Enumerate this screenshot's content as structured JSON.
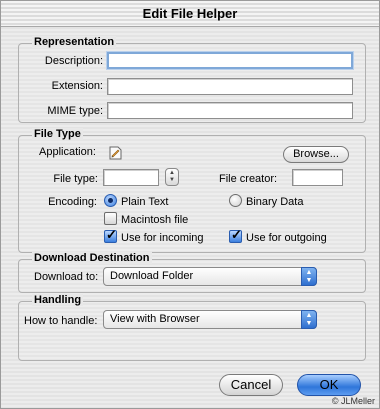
{
  "window": {
    "title": "Edit File Helper"
  },
  "representation": {
    "group_label": "Representation",
    "description_label": "Description:",
    "description_value": "",
    "extension_label": "Extension:",
    "extension_value": "",
    "mime_label": "MIME type:",
    "mime_value": ""
  },
  "file_type": {
    "group_label": "File Type",
    "application_label": "Application:",
    "application_icon": "application-document-icon",
    "browse_label": "Browse...",
    "file_type_label": "File type:",
    "file_type_value": "",
    "file_creator_label": "File creator:",
    "file_creator_value": "",
    "encoding_label": "Encoding:",
    "encoding_options": [
      "Plain Text",
      "Binary Data"
    ],
    "encoding_selected": "Plain Text",
    "macintosh_file_label": "Macintosh file",
    "macintosh_file_checked": false,
    "use_incoming_label": "Use for incoming",
    "use_incoming_checked": true,
    "use_outgoing_label": "Use for outgoing",
    "use_outgoing_checked": true
  },
  "download": {
    "group_label": "Download Destination",
    "download_to_label": "Download to:",
    "download_to_value": "Download Folder"
  },
  "handling": {
    "group_label": "Handling",
    "how_to_handle_label": "How to handle:",
    "how_to_handle_value": "View with Browser"
  },
  "buttons": {
    "cancel": "Cancel",
    "ok": "OK"
  },
  "watermark": "© JLMeller",
  "colors": {
    "accent": "#3b7fde",
    "focus_ring": "#7fa8d8"
  }
}
